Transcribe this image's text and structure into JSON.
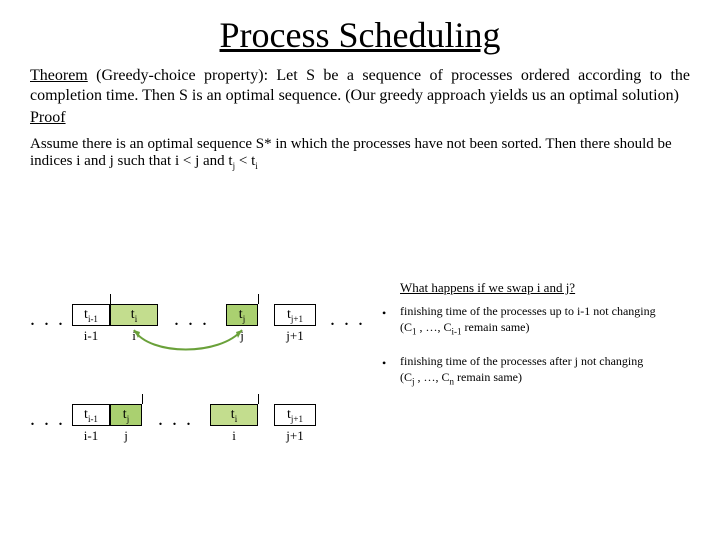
{
  "title": "Process Scheduling",
  "theorem_label": "Theorem",
  "theorem_body": " (Greedy-choice property): Let S be a sequence of processes ordered according to the completion time. Then S is an optimal sequence. (Our greedy approach yields us an optimal solution)",
  "proof_label": "Proof",
  "assume": "Assume there is an optimal sequence S* in which the processes have not been sorted. Then there should be indices i and j such that i < j and t",
  "assume_tail1": " < t",
  "ellipsis": ". . .",
  "row1": {
    "b1": "t",
    "b1s": "i-1",
    "c1": "i-1",
    "b2": "t",
    "b2s": "i",
    "c2": "i",
    "b3": "t",
    "b3s": "j",
    "c3": "j",
    "b4": "t",
    "b4s": "j+1",
    "c4": "j+1"
  },
  "row2": {
    "b1": "t",
    "b1s": "i-1",
    "c1": "i-1",
    "b2": "t",
    "b2s": "j",
    "c2": "j",
    "b3": "t",
    "b3s": "i",
    "c3": "i",
    "b4": "t",
    "b4s": "j+1",
    "c4": "j+1"
  },
  "swap_q": "What happens if we swap i and j?",
  "bullets": {
    "b1a": "finishing time of the processes up to i-1 not changing",
    "b1b": "(C",
    "b1b_s1": "1",
    "b1b_mid": " , …, C",
    "b1b_s2": "i-1",
    "b1b_end": " remain same)",
    "b2a": "finishing time of the processes after j not changing",
    "b2b": "(C",
    "b2b_s1": "j",
    "b2b_mid": " , …, C",
    "b2b_s2": "n",
    "b2b_end": " remain same)"
  }
}
